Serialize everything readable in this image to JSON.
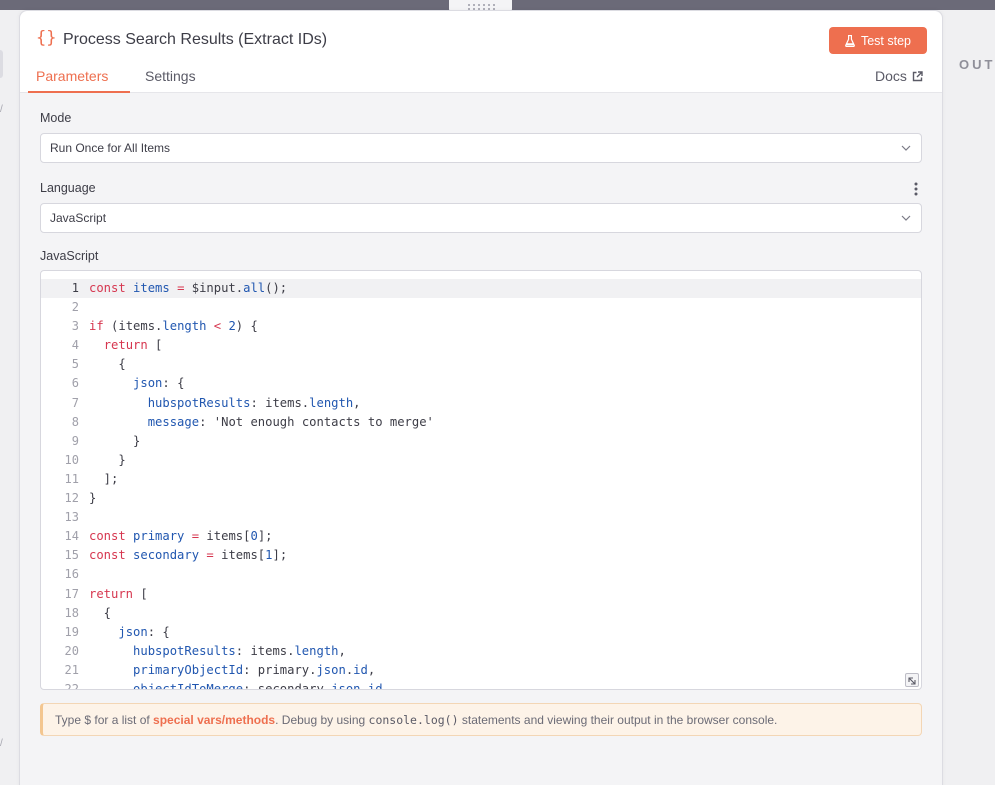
{
  "node": {
    "title": "Process Search Results (Extract IDs)",
    "icon": "code-braces-icon"
  },
  "header": {
    "test_step_label": "Test step",
    "docs_label": "Docs"
  },
  "tabs": [
    {
      "label": "Parameters",
      "active": true
    },
    {
      "label": "Settings",
      "active": false
    }
  ],
  "side_panel": {
    "output_label": "OUT"
  },
  "fields": {
    "mode": {
      "label": "Mode",
      "value": "Run Once for All Items"
    },
    "language": {
      "label": "Language",
      "value": "JavaScript"
    },
    "code": {
      "label": "JavaScript"
    }
  },
  "code_lines": [
    "const items = $input.all();",
    "",
    "if (items.length < 2) {",
    "  return [",
    "    {",
    "      json: {",
    "        hubspotResults: items.length,",
    "        message: 'Not enough contacts to merge'",
    "      }",
    "    }",
    "  ];",
    "}",
    "",
    "const primary = items[0];",
    "const secondary = items[1];",
    "",
    "return [",
    "  {",
    "    json: {",
    "      hubspotResults: items.length,",
    "      primaryObjectId: primary.json.id,",
    "      objectIdToMerge: secondary.json.id"
  ],
  "hint": {
    "prefix": "Type $ for a list of ",
    "link": "special vars/methods",
    "middle": ". Debug by using ",
    "code": "console.log()",
    "suffix": " statements and viewing their output in the browser console."
  },
  "colors": {
    "accent": "#ee6f4f",
    "keyword": "#d6364f",
    "property": "#2157b0"
  }
}
